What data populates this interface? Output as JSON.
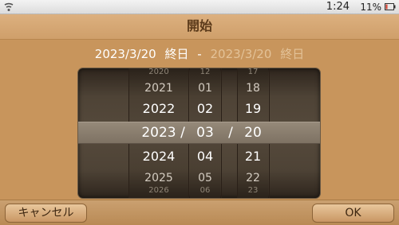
{
  "status": {
    "time": "1:24",
    "battery_percent": "11%",
    "icons": [
      "wifi-icon",
      "battery-icon"
    ]
  },
  "title": "開始",
  "range": {
    "start_date": "2023/3/20",
    "start_label": "終日",
    "separator": "-",
    "end_date": "2023/3/20",
    "end_label": "終日"
  },
  "picker": {
    "year": {
      "above3": "2020",
      "above2": "2021",
      "above1": "2022",
      "selected": "2023",
      "below1": "2024",
      "below2": "2025",
      "below3": "2026"
    },
    "month": {
      "above3": "12",
      "above2": "01",
      "above1": "02",
      "selected": "03",
      "below1": "04",
      "below2": "05",
      "below3": "06"
    },
    "day": {
      "above3": "17",
      "above2": "18",
      "above1": "19",
      "selected": "20",
      "below1": "21",
      "below2": "22",
      "below3": "23"
    },
    "slash": "/"
  },
  "buttons": {
    "cancel": "キャンセル",
    "ok": "OK"
  },
  "colors": {
    "background": "#c8955c",
    "title_text": "#5b3a1a",
    "picker_dark": "#2e251d",
    "highlight": "#8a7e6e"
  }
}
